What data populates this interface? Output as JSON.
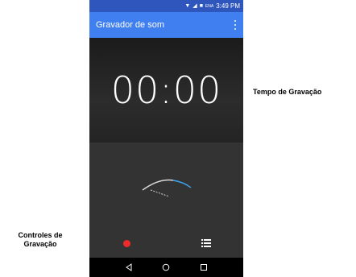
{
  "status_bar": {
    "network": "ENA",
    "time": "3:49 PM"
  },
  "app_bar": {
    "title": "Gravador de som"
  },
  "timer": {
    "value": "00:00"
  },
  "labels": {
    "recording_time": "Tempo de Gravação",
    "recording_controls_line1": "Controles de",
    "recording_controls_line2": "Gravação"
  },
  "icons": {
    "record": "record-icon",
    "list": "list-icon",
    "more": "more-vertical-icon",
    "back": "back-icon",
    "home": "home-icon",
    "recents": "recents-icon",
    "wifi": "wifi-icon",
    "signal": "signal-icon",
    "battery": "battery-icon"
  },
  "colors": {
    "status_bar": "#2f56bd",
    "app_bar": "#3f7ff0",
    "record": "#ef2a2a",
    "dial_accent": "#3ea8f5"
  }
}
